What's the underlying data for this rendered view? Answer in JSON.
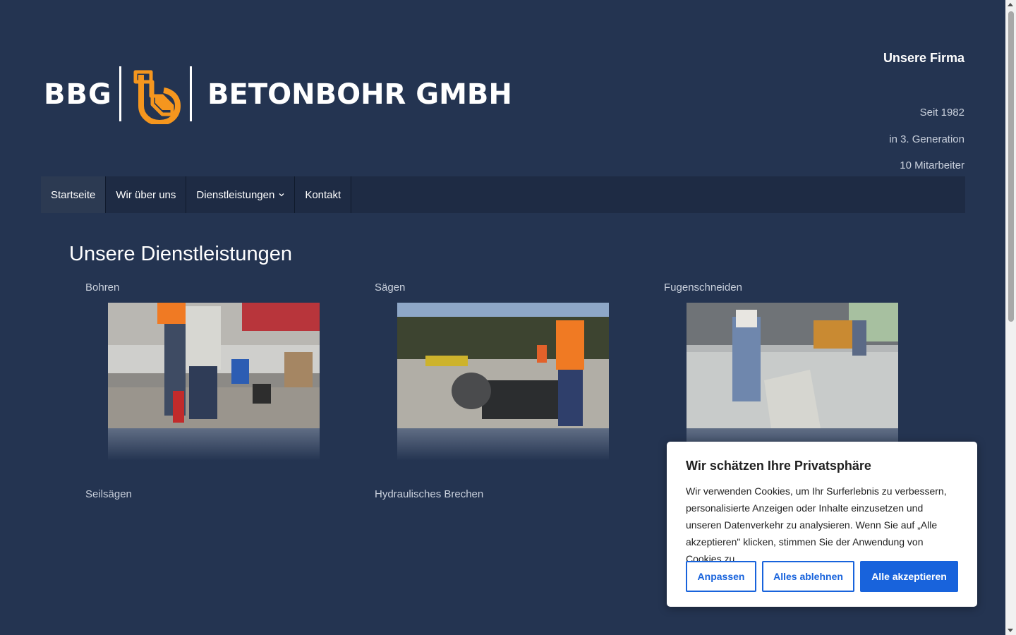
{
  "logo": {
    "abbr": "BBG",
    "name": "BETONBOHR GMBH",
    "accent_color": "#f5961e"
  },
  "header": {
    "firm_title": "Unsere Firma",
    "facts": [
      "Seit 1982",
      "in 3. Generation",
      "10 Mitarbeiter"
    ]
  },
  "nav": {
    "items": [
      {
        "label": "Startseite",
        "active": true
      },
      {
        "label": "Wir über uns"
      },
      {
        "label": "Dienstleistungen",
        "has_dropdown": true
      },
      {
        "label": "Kontakt"
      }
    ]
  },
  "main": {
    "title": "Unsere Dienstleistungen",
    "services": [
      {
        "label": "Bohren"
      },
      {
        "label": "Sägen"
      },
      {
        "label": "Fugenschneiden"
      },
      {
        "label": "Seilsägen"
      },
      {
        "label": "Hydraulisches Brechen"
      }
    ]
  },
  "cookie": {
    "title": "Wir schätzen Ihre Privatsphäre",
    "text": "Wir verwenden Cookies, um Ihr Surferlebnis zu verbessern, personalisierte Anzeigen oder Inhalte einzusetzen und unseren Datenverkehr zu analysieren. Wenn Sie auf „Alle akzeptieren\" klicken, stimmen Sie der Anwendung von Cookies zu.",
    "buttons": {
      "customize": "Anpassen",
      "reject": "Alles ablehnen",
      "accept": "Alle akzeptieren"
    },
    "accent_color": "#1863dc"
  },
  "colors": {
    "background": "#243451",
    "nav_background": "#1e2b44"
  }
}
